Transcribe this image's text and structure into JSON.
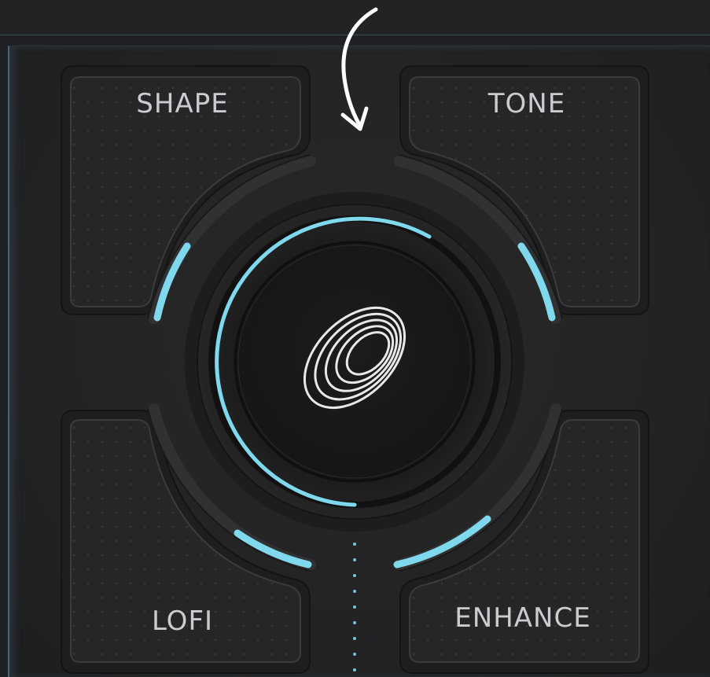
{
  "pads": {
    "top_left": {
      "label": "SHAPE"
    },
    "top_right": {
      "label": "TONE"
    },
    "bottom_left": {
      "label": "LOFI"
    },
    "bottom_right": {
      "label": "ENHANCE"
    }
  },
  "colors": {
    "accent": "#7fd8ec",
    "background": "#222325",
    "panel": "#242425",
    "pad_fill": "#262627",
    "label_text": "#c9ccd0"
  },
  "icons": {
    "center": "concentric-rings-logo",
    "annotation": "curved-arrow-down"
  }
}
